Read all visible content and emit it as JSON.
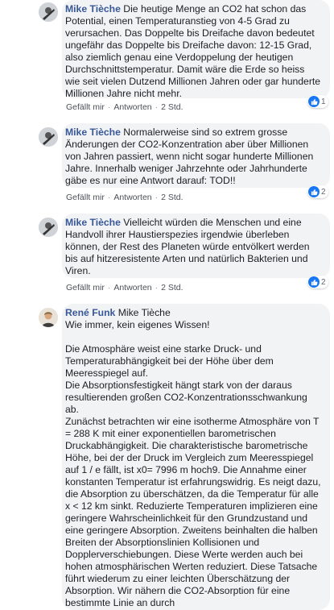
{
  "comments": [
    {
      "author": "Mike Tièche",
      "text": "Die heutige Menge an CO2 hat schon das Potential, einen Temperaturanstieg von 4-5 Grad zu verursachen. Das Doppelte bis Dreifache davon bedeutet ungefähr das Doppelte bis Dreifache davon: 12-15 Grad, also ziemlich genau eine Verdoppelung der heutigen Durchschnittstemperatur. Damit wäre die Erde so heiss wie seit vielen Dutzend Millionen Jahren oder gar hunderte Millionen Jahre nicht mehr.",
      "like": "Gefällt mir",
      "reply": "Antworten",
      "time": "2 Std.",
      "reactions": "1"
    },
    {
      "author": "Mike Tièche",
      "text": "Normalerweise sind so extrem grosse Änderungen der CO2-Konzentration aber über Millionen von Jahren passiert, wenn nicht sogar hunderte Millionen Jahre. Innerhalb weniger Jahrzehnte oder Jahrhunderte gäbe es nur eine Antwort darauf: TOD!!",
      "like": "Gefällt mir",
      "reply": "Antworten",
      "time": "2 Std.",
      "reactions": "2"
    },
    {
      "author": "Mike Tièche",
      "text": "Vielleicht würden die Menschen und eine Handvoll ihrer Haustierspezies irgendwie überleben können, der Rest des Planeten würde entvölkert werden bis auf hitzeresistente Arten und natürlich Bakterien und Viren.",
      "like": "Gefällt mir",
      "reply": "Antworten",
      "time": "2 Std.",
      "reactions": "2"
    },
    {
      "author": "René Funk",
      "mention": "Mike Tièche",
      "text": "Wie immer, kein eigenes Wissen!\n\nDie Atmosphäre weist eine starke Druck- und Temperaturabhängigkeit bei der Höhe über dem Meeresspiegel auf.\nDie Absorptionsfestigkeit hängt stark von der daraus resultierenden großen CO2-Konzentrationsschwankung ab.\nZunächst betrachten wir eine isotherme Atmosphäre von T = 288 K mit einer exponentiellen barometrischen Druckabhängigkeit. Die charakteristische barometrische Höhe, bei der der Druck im Vergleich zum Meeresspiegel auf 1 / e fällt, ist x0= 7996 m hoch9. Die Annahme einer konstanten Temperatur ist erfahrungswidrig. Es neigt dazu, die Absorption zu überschätzen, da die Temperatur für alle x < 12 km sinkt. Reduzierte Temperaturen implizieren eine geringere Wahrscheinlichkeit für den Grundzustand und eine geringere Absorption. Zweitens beinhalten die halben Breiten der Absorptionslinien Kollisionen und Dopplerverschiebungen. Diese Werte werden auch bei hohen atmosphärischen Werten reduziert. Diese Tatsache führt wiederum zu einer leichten Überschätzung der Absorption. Wir nähern die CO2-Absorption für eine bestimmte Linie an durch"
    }
  ],
  "colors": {
    "name": "#385898",
    "bubble": "#f2f3f5",
    "like": "#1877f2"
  }
}
